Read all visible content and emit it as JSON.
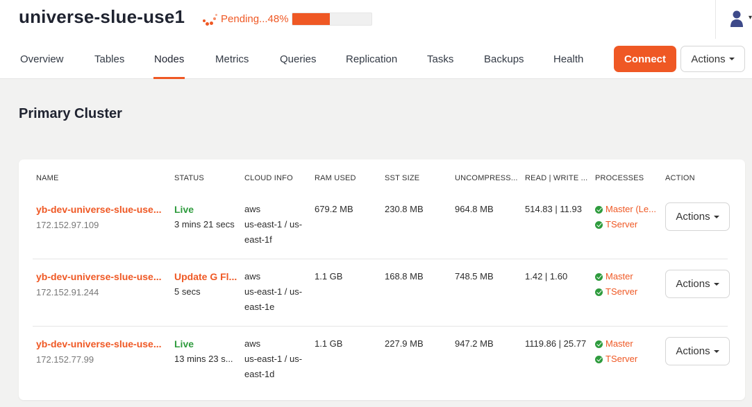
{
  "universe": {
    "title": "universe-slue-use1",
    "pending_text": "Pending...48%",
    "progress": 0.48
  },
  "tabs": [
    {
      "label": "Overview"
    },
    {
      "label": "Tables"
    },
    {
      "label": "Nodes",
      "active": true
    },
    {
      "label": "Metrics"
    },
    {
      "label": "Queries"
    },
    {
      "label": "Replication"
    },
    {
      "label": "Tasks"
    },
    {
      "label": "Backups"
    },
    {
      "label": "Health"
    }
  ],
  "toolbar": {
    "connect_label": "Connect",
    "actions_label": "Actions"
  },
  "section": {
    "title": "Primary Cluster"
  },
  "table": {
    "headers": [
      "NAME",
      "STATUS",
      "CLOUD INFO",
      "RAM USED",
      "SST SIZE",
      "UNCOMPRESS...",
      "READ | WRITE ...",
      "PROCESSES",
      "ACTION"
    ],
    "rows": [
      {
        "name": "yb-dev-universe-slue-use...",
        "ip": "172.152.97.109",
        "status": "Live",
        "status_kind": "live",
        "status_detail": "3 mins 21 secs",
        "cloud_line1": "aws",
        "cloud_line2": "us-east-1 / us-",
        "cloud_line3": "east-1f",
        "ram_used": "679.2 MB",
        "sst_size": "230.8 MB",
        "uncompressed": "964.8 MB",
        "read_write": "514.83 | 11.93",
        "process_1": "Master (Le...",
        "process_2": "TServer",
        "action_label": "Actions"
      },
      {
        "name": "yb-dev-universe-slue-use...",
        "ip": "172.152.91.244",
        "status": "Update G Fl...",
        "status_kind": "warn",
        "status_detail": "5 secs",
        "cloud_line1": "aws",
        "cloud_line2": "us-east-1 / us-",
        "cloud_line3": "east-1e",
        "ram_used": "1.1 GB",
        "sst_size": "168.8 MB",
        "uncompressed": "748.5 MB",
        "read_write": "1.42 | 1.60",
        "process_1": "Master",
        "process_2": "TServer",
        "action_label": "Actions"
      },
      {
        "name": "yb-dev-universe-slue-use...",
        "ip": "172.152.77.99",
        "status": "Live",
        "status_kind": "live",
        "status_detail": "13 mins 23 s...",
        "cloud_line1": "aws",
        "cloud_line2": "us-east-1 / us-",
        "cloud_line3": "east-1d",
        "ram_used": "1.1 GB",
        "sst_size": "227.9 MB",
        "uncompressed": "947.2 MB",
        "read_write": "1119.86 | 25.77",
        "process_1": "Master",
        "process_2": "TServer",
        "action_label": "Actions"
      }
    ]
  },
  "icons": {
    "spinner": "loading-spinner-icon",
    "user": "user-icon",
    "caret": "caret-down-icon",
    "check": "check-circle-icon"
  },
  "colors": {
    "accent": "#ef5824",
    "live": "#2e9b3d",
    "background": "#f2f2f1"
  }
}
